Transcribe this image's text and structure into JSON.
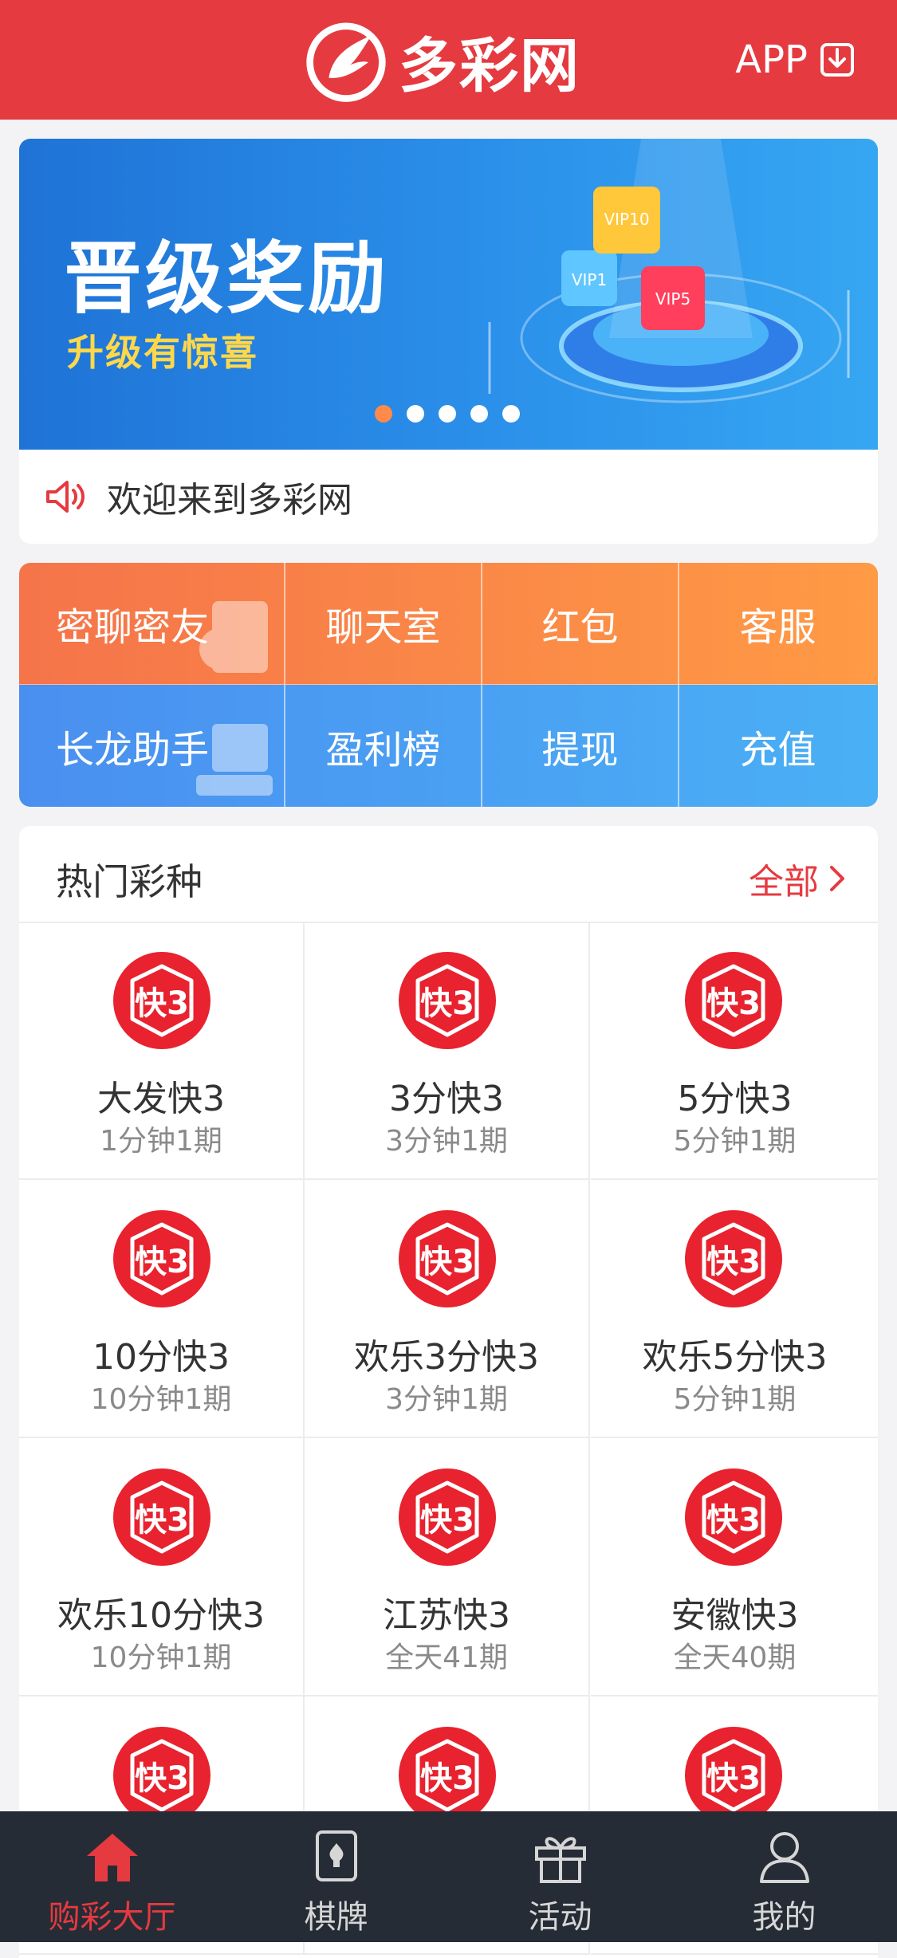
{
  "header": {
    "brand": "多彩网",
    "app_label": "APP",
    "colors": {
      "bg": "#e53a40",
      "fg": "#ffffff"
    }
  },
  "banner": {
    "title": "晋级奖励",
    "subtitle": "升级有惊喜",
    "badges": [
      "VIP10",
      "VIP1",
      "VIP5"
    ],
    "dots_total": 5,
    "active_dot": 1
  },
  "notice": {
    "icon": "speaker-icon",
    "text": "欢迎来到多彩网"
  },
  "quick": {
    "top": [
      "密聊密友",
      "聊天室",
      "红包",
      "客服"
    ],
    "bottom": [
      "长龙助手",
      "盈利榜",
      "提现",
      "充值"
    ]
  },
  "hot": {
    "title": "热门彩种",
    "more": "全部",
    "items": [
      {
        "name": "大发快3",
        "sub": "1分钟1期"
      },
      {
        "name": "3分快3",
        "sub": "3分钟1期"
      },
      {
        "name": "5分快3",
        "sub": "5分钟1期"
      },
      {
        "name": "10分快3",
        "sub": "10分钟1期"
      },
      {
        "name": "欢乐3分快3",
        "sub": "3分钟1期"
      },
      {
        "name": "欢乐5分快3",
        "sub": "5分钟1期"
      },
      {
        "name": "欢乐10分快3",
        "sub": "10分钟1期"
      },
      {
        "name": "江苏快3",
        "sub": "全天41期"
      },
      {
        "name": "安徽快3",
        "sub": "全天40期"
      }
    ],
    "icon_label": "快3"
  },
  "tabbar": {
    "items": [
      {
        "label": "购彩大厅",
        "icon": "home-icon",
        "active": true
      },
      {
        "label": "棋牌",
        "icon": "cards-icon",
        "active": false
      },
      {
        "label": "活动",
        "icon": "gift-icon",
        "active": false
      },
      {
        "label": "我的",
        "icon": "user-icon",
        "active": false
      }
    ],
    "colors": {
      "bg": "#262c36",
      "active": "#e53a40",
      "inactive": "#d6d6d6"
    }
  }
}
